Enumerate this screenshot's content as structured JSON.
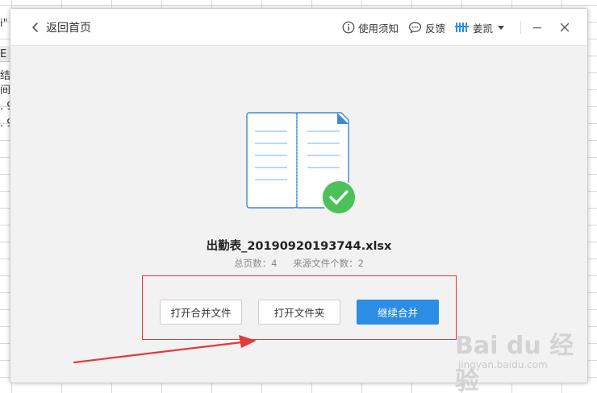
{
  "background_sheet": {
    "fragments": [
      "i\"",
      "E",
      "结",
      "间",
      ". 9",
      ". 9"
    ]
  },
  "titlebar": {
    "back_label": "返回首页",
    "notice_label": "使用须知",
    "feedback_label": "反馈",
    "user_name": "姜凯"
  },
  "result": {
    "file_name": "出勤表_20190920193744.xlsx",
    "total_pages": "总页数：4",
    "source_files": "来源文件个数：2"
  },
  "actions": {
    "open_merged_label": "打开合并文件",
    "open_folder_label": "打开文件夹",
    "continue_label": "继续合并"
  },
  "watermark": {
    "logo_text": "Bai du 经验",
    "url": "jingyan.baidu.com"
  },
  "colors": {
    "accent": "#2b8de3",
    "success": "#4cc15a",
    "highlight": "#e23b3b",
    "doc_line": "#8fc3ea"
  },
  "icons": [
    "chevron-left-icon",
    "info-icon",
    "feedback-icon",
    "user-logo-icon",
    "caret-down-icon",
    "minimize-icon",
    "close-icon",
    "document-icon",
    "check-circle-icon"
  ]
}
